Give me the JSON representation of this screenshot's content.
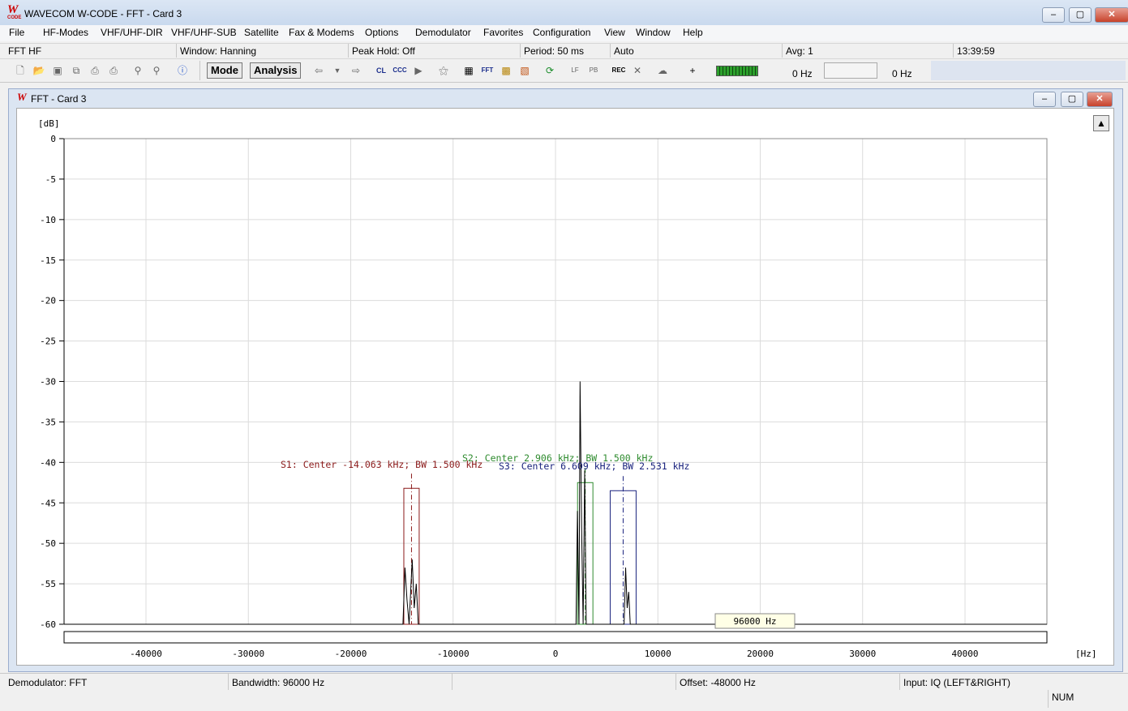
{
  "app": {
    "logo": "W",
    "logo_sub": "CODE",
    "title": "WAVECOM W-CODE - FFT  - Card 3"
  },
  "window_controls": {
    "minimize": "–",
    "maximize": "▢",
    "close": "✕"
  },
  "menu": [
    "File",
    "HF-Modes",
    "VHF/UHF-DIR",
    "VHF/UHF-SUB",
    "Satellite",
    "Fax & Modems",
    "Options",
    "Demodulator",
    "Favorites",
    "Configuration",
    "View",
    "Window",
    "Help"
  ],
  "info": {
    "mode": "FFT HF",
    "window": "Window: Hanning",
    "peak_hold": "Peak Hold: Off",
    "period": "Period: 50 ms",
    "auto": "Auto",
    "avg": "Avg: 1",
    "time": "13:39:59"
  },
  "toolbar": {
    "mode_label": "Mode",
    "analysis_label": "Analysis",
    "freq_left": "0 Hz",
    "freq_right": "0 Hz",
    "icons": {
      "cl": "CL",
      "ccc": "CCC",
      "fft": "FFT",
      "rec": "REC",
      "lf": "LF",
      "pb": "PB"
    }
  },
  "inner_window": {
    "title": "FFT  - Card 3"
  },
  "chart_data": {
    "type": "line",
    "ylabel": "[dB]",
    "xlabel": "[Hz]",
    "xlim": [
      -48000,
      48000
    ],
    "ylim": [
      -60,
      0
    ],
    "y_ticks": [
      0,
      -5,
      -10,
      -15,
      -20,
      -25,
      -30,
      -35,
      -40,
      -45,
      -50,
      -55,
      -60
    ],
    "x_ticks": [
      -40000,
      -30000,
      -20000,
      -10000,
      0,
      10000,
      20000,
      30000,
      40000
    ],
    "grid": true,
    "bandwidth_box": "96000 Hz",
    "signals": [
      {
        "label": "S1: Center -14.063 kHz; BW 1.500 kHz",
        "center": -14063,
        "bw": 1500,
        "top": -43.2,
        "color": "#8b1a1a"
      },
      {
        "label": "S2: Center 2.906 kHz; BW 1.500 kHz",
        "center": 2906,
        "bw": 1500,
        "top": -42.5,
        "color": "#2e8b2e"
      },
      {
        "label": "S3: Center 6.609 kHz; BW 2.531 kHz",
        "center": 6609,
        "bw": 2531,
        "top": -43.5,
        "color": "#1a237e"
      }
    ],
    "spectrum": [
      [
        -48000,
        -60
      ],
      [
        -14900,
        -60
      ],
      [
        -14700,
        -53
      ],
      [
        -14500,
        -57
      ],
      [
        -14300,
        -60
      ],
      [
        -14000,
        -52
      ],
      [
        -13800,
        -58
      ],
      [
        -13600,
        -55
      ],
      [
        -13400,
        -60
      ],
      [
        2000,
        -60
      ],
      [
        2150,
        -46
      ],
      [
        2300,
        -60
      ],
      [
        2400,
        -30
      ],
      [
        2550,
        -48
      ],
      [
        2700,
        -60
      ],
      [
        2850,
        -41
      ],
      [
        3000,
        -60
      ],
      [
        6700,
        -60
      ],
      [
        6850,
        -53
      ],
      [
        7000,
        -58
      ],
      [
        7150,
        -56
      ],
      [
        7300,
        -60
      ],
      [
        48000,
        -60
      ]
    ],
    "spectrum_color": "#000000"
  },
  "status": {
    "demodulator": "Demodulator: FFT",
    "bandwidth": "Bandwidth: 96000 Hz",
    "offset": "Offset: -48000 Hz",
    "input": "Input: IQ (LEFT&RIGHT)",
    "num": "NUM"
  }
}
